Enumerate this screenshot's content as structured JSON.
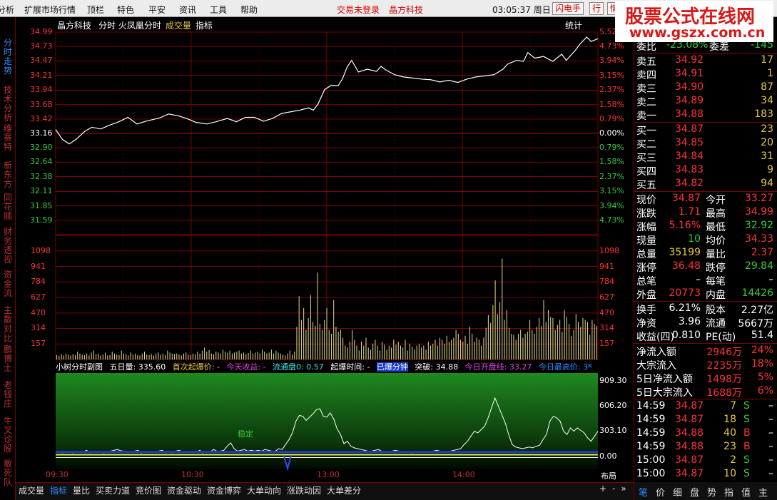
{
  "menubar": {
    "items": [
      "分析",
      "扩展市场行情",
      "顶栏",
      "特色",
      "平安",
      "资讯",
      "工具",
      "帮助"
    ],
    "status_login": "交易未登录",
    "status_stock": "晶方科技",
    "clock": "03:05:37",
    "weekday": "周日",
    "flash_button": "闪电手",
    "hang_button": "行",
    "info_button": "情"
  },
  "ad": {
    "title": "股票公式在线网",
    "url": "www.gszx.com.cn"
  },
  "left_tabs": [
    {
      "label": "分时走势",
      "active": true
    },
    {
      "label": "技术分析",
      "active": false
    },
    {
      "label": "维赛特",
      "active": false
    },
    {
      "label": "新东方",
      "active": false
    },
    {
      "label": "同花顺",
      "active": false
    },
    {
      "label": "财务透视",
      "active": false
    },
    {
      "label": "资金流",
      "active": false
    },
    {
      "label": "主散对比",
      "active": false
    },
    {
      "label": "鹏博士",
      "active": false
    },
    {
      "label": "老钱庄",
      "active": false
    },
    {
      "label": "牛叉诊股",
      "active": false
    },
    {
      "label": "敢死队",
      "active": false
    }
  ],
  "chart_header": {
    "stock_name": "晶方科技",
    "options": "分时 火凤凰分时",
    "volume": "成交量",
    "indicator": "指标",
    "stat_button": "统计"
  },
  "colors": {
    "up": "#ff3232",
    "down": "#33cc33",
    "grid": "#7a0000",
    "price_line": "#ffffff",
    "volume": "#e6dc8c",
    "equal": "#ffffff"
  },
  "chart_data": [
    {
      "type": "line",
      "name": "price",
      "ylim": [
        31.33,
        34.99
      ],
      "prev_close": 33.16,
      "left_ticks": [
        "34.99",
        "34.73",
        "34.47",
        "34.21",
        "33.94",
        "33.68",
        "33.42",
        "33.16",
        "32.90",
        "32.64",
        "32.38",
        "32.11",
        "31.85",
        "31.59"
      ],
      "right_ticks": [
        "5.52%",
        "4.73%",
        "3.94%",
        "3.15%",
        "2.37%",
        "1.58%",
        "0.79%",
        "0.00%",
        "0.79%",
        "1.58%",
        "2.37%",
        "3.15%",
        "3.94%",
        "4.73%"
      ],
      "x_ticks": [
        "09:30",
        "10:30",
        "13:00",
        "14:00"
      ],
      "x_minutes": 240,
      "points": [
        [
          0,
          33.23
        ],
        [
          3,
          33.05
        ],
        [
          6,
          32.97
        ],
        [
          9,
          33.05
        ],
        [
          13,
          33.2
        ],
        [
          16,
          33.27
        ],
        [
          20,
          33.24
        ],
        [
          24,
          33.31
        ],
        [
          28,
          33.37
        ],
        [
          32,
          33.45
        ],
        [
          36,
          33.33
        ],
        [
          40,
          33.38
        ],
        [
          46,
          33.44
        ],
        [
          50,
          33.51
        ],
        [
          54,
          33.48
        ],
        [
          58,
          33.43
        ],
        [
          62,
          33.36
        ],
        [
          67,
          33.33
        ],
        [
          71,
          33.37
        ],
        [
          76,
          33.43
        ],
        [
          80,
          33.37
        ],
        [
          84,
          33.45
        ],
        [
          88,
          33.45
        ],
        [
          92,
          33.38
        ],
        [
          96,
          33.43
        ],
        [
          100,
          33.52
        ],
        [
          104,
          33.55
        ],
        [
          108,
          33.58
        ],
        [
          112,
          33.62
        ],
        [
          114,
          33.58
        ],
        [
          116,
          33.68
        ],
        [
          119,
          33.95
        ],
        [
          122,
          34.03
        ],
        [
          125,
          34.02
        ],
        [
          127,
          34.15
        ],
        [
          129,
          34.36
        ],
        [
          131,
          34.48
        ],
        [
          134,
          34.27
        ],
        [
          138,
          34.32
        ],
        [
          142,
          34.28
        ],
        [
          144,
          34.37
        ],
        [
          146,
          34.31
        ],
        [
          150,
          34.22
        ],
        [
          154,
          34.18
        ],
        [
          158,
          34.16
        ],
        [
          162,
          34.14
        ],
        [
          166,
          34.13
        ],
        [
          170,
          34.09
        ],
        [
          174,
          34.12
        ],
        [
          178,
          34.08
        ],
        [
          182,
          34.14
        ],
        [
          186,
          34.18
        ],
        [
          190,
          34.2
        ],
        [
          194,
          34.22
        ],
        [
          198,
          34.32
        ],
        [
          200,
          34.41
        ],
        [
          204,
          34.48
        ],
        [
          207,
          34.46
        ],
        [
          209,
          34.62
        ],
        [
          212,
          34.52
        ],
        [
          216,
          34.55
        ],
        [
          220,
          34.46
        ],
        [
          224,
          34.59
        ],
        [
          226,
          34.48
        ],
        [
          230,
          34.66
        ],
        [
          232,
          34.77
        ],
        [
          235,
          34.9
        ],
        [
          237,
          34.82
        ],
        [
          240,
          34.87
        ]
      ]
    },
    {
      "type": "bar",
      "name": "volume",
      "ylim": [
        0,
        1255
      ],
      "ticks": [
        "1098",
        "941",
        "784",
        "627",
        "470",
        "314",
        "157"
      ],
      "values": [
        45,
        35,
        55,
        40,
        60,
        50,
        40,
        55,
        45,
        80,
        60,
        50,
        45,
        60,
        40,
        70,
        90,
        55,
        60,
        40,
        50,
        70,
        40,
        45,
        80,
        60,
        50,
        45,
        90,
        60,
        55,
        40,
        70,
        50,
        60,
        45,
        40,
        60,
        80,
        50,
        45,
        55,
        40,
        60,
        70,
        50,
        60,
        45,
        90,
        70,
        60,
        55,
        60,
        50,
        40,
        60,
        70,
        50,
        45,
        60,
        50,
        80,
        60,
        90,
        120,
        80,
        95,
        60,
        50,
        80,
        70,
        60,
        100,
        80,
        70,
        90,
        60,
        70,
        80,
        90,
        60,
        70,
        55,
        65,
        90,
        60,
        70,
        80,
        60,
        100,
        80,
        60,
        70,
        100,
        60,
        90,
        70,
        60,
        50,
        40,
        60,
        90,
        50,
        80,
        330,
        640,
        400,
        520,
        300,
        420,
        650,
        380,
        340,
        880,
        360,
        300,
        400,
        520,
        300,
        260,
        600,
        330,
        280,
        300,
        220,
        140,
        120,
        180,
        300,
        200,
        140,
        90,
        180,
        140,
        220,
        120,
        100,
        160,
        200,
        140,
        90,
        180,
        150,
        100,
        140,
        120,
        200,
        150,
        180,
        140,
        120,
        200,
        90,
        160,
        130,
        100,
        140,
        160,
        120,
        140,
        100,
        180,
        140,
        160,
        200,
        140,
        220,
        200,
        160,
        240,
        180,
        200,
        220,
        300,
        260,
        200,
        180,
        240,
        160,
        330,
        260,
        180,
        220,
        200,
        140,
        220,
        320,
        450,
        370,
        550,
        800,
        460,
        580,
        1020,
        400,
        500,
        320,
        260,
        250,
        200,
        260,
        300,
        220,
        260,
        280,
        400,
        300,
        260,
        330,
        420,
        340,
        600,
        380,
        500,
        430,
        420,
        300,
        350,
        400,
        280,
        500,
        430,
        360,
        240,
        300,
        460,
        380,
        330,
        420,
        400,
        380,
        250,
        400,
        360,
        340
      ]
    },
    {
      "type": "area",
      "name": "小树分时副图",
      "ylim": [
        -150,
        1000
      ],
      "ticks": [
        "909.30",
        "606.20",
        "303.10",
        "0.00"
      ],
      "annotation": "稳定",
      "values": [
        60,
        50,
        40,
        60,
        50,
        40,
        55,
        60,
        50,
        70,
        40,
        50,
        60,
        55,
        40,
        50,
        60,
        70,
        80,
        65,
        60,
        50,
        55,
        60,
        70,
        40,
        60,
        50,
        45,
        55,
        60,
        70,
        50,
        60,
        40,
        60,
        70,
        50,
        60,
        55,
        60,
        50,
        70,
        40,
        60,
        50,
        80,
        60,
        60,
        70,
        120,
        160,
        90,
        60,
        70,
        80,
        60,
        70,
        60,
        70,
        60,
        80,
        70,
        60,
        60,
        90,
        80,
        140,
        200,
        280,
        420,
        490,
        480,
        430,
        470,
        510,
        560,
        570,
        480,
        470,
        520,
        450,
        330,
        260,
        150,
        180,
        120,
        100,
        90,
        80,
        70,
        60,
        60,
        70,
        80,
        60,
        60,
        50,
        60,
        70,
        60,
        60,
        50,
        60,
        40,
        55,
        60,
        50,
        60,
        50,
        60,
        70,
        60,
        50,
        60,
        60,
        70,
        80,
        90,
        140,
        180,
        240,
        300,
        280,
        320,
        360,
        460,
        580,
        700,
        600,
        500,
        400,
        260,
        140,
        110,
        100,
        90,
        100,
        110,
        100,
        120,
        130,
        200,
        260,
        420,
        480,
        460,
        420,
        300,
        260,
        340,
        300,
        340,
        310,
        280,
        220,
        180,
        240,
        300
      ]
    }
  ],
  "indicator_header": {
    "name": "小树分时副图",
    "five_day": "五日量: 335.60",
    "first_surge": "首次起爆价: -",
    "today_gain": "今天收益: -",
    "float_cap": "流通盘0: 0.57",
    "surge_time": "起爆时间: -",
    "exploded": "已爆分钟",
    "breakthrough": "突破: 34.88",
    "today_open": "今日开盘线: 33.27",
    "today_high": "今日最高价: 3"
  },
  "bottom_tabs": [
    {
      "label": "成交量",
      "active": false
    },
    {
      "label": "指标",
      "active": true
    },
    {
      "label": "量比",
      "active": false
    },
    {
      "label": "买卖力道",
      "active": false
    },
    {
      "label": "竞价图",
      "active": false
    },
    {
      "label": "资金驱动",
      "active": false
    },
    {
      "label": "资金博弈",
      "active": false
    },
    {
      "label": "大单动向",
      "active": false
    },
    {
      "label": "涨跌动因",
      "active": false
    },
    {
      "label": "大单差分",
      "active": false
    }
  ],
  "layout_button": "布局",
  "zoom_buttons": [
    "+",
    "-",
    "»"
  ],
  "quote_panel": {
    "ratio_row": {
      "label1": "委比",
      "value1": "-23.08%",
      "label2": "委差",
      "value2": "-145"
    },
    "asks": [
      {
        "label": "卖五",
        "price": "34.92",
        "volume": "17"
      },
      {
        "label": "卖四",
        "price": "34.91",
        "volume": "1"
      },
      {
        "label": "卖三",
        "price": "34.90",
        "volume": "87"
      },
      {
        "label": "卖二",
        "price": "34.89",
        "volume": "34"
      },
      {
        "label": "卖一",
        "price": "34.88",
        "volume": "183"
      }
    ],
    "bids": [
      {
        "label": "买一",
        "price": "34.87",
        "volume": "23"
      },
      {
        "label": "买二",
        "price": "34.85",
        "volume": "20"
      },
      {
        "label": "买三",
        "price": "34.84",
        "volume": "31"
      },
      {
        "label": "买四",
        "price": "34.83",
        "volume": "9"
      },
      {
        "label": "买五",
        "price": "34.82",
        "volume": "94"
      }
    ],
    "stats": [
      {
        "l1": "现价",
        "v1": "34.87",
        "c1": "up",
        "l2": "今开",
        "v2": "33.27",
        "c2": "up"
      },
      {
        "l1": "涨跌",
        "v1": "1.71",
        "c1": "up",
        "l2": "最高",
        "v2": "34.99",
        "c2": "up"
      },
      {
        "l1": "涨幅",
        "v1": "5.16%",
        "c1": "up",
        "l2": "最低",
        "v2": "32.92",
        "c2": "down"
      },
      {
        "l1": "现量",
        "v1": "10",
        "c1": "down",
        "l2": "均价",
        "v2": "34.33",
        "c2": "up"
      },
      {
        "l1": "总量",
        "v1": "35199",
        "c1": "yellow",
        "l2": "量比",
        "v2": "2.37",
        "c2": "up"
      },
      {
        "l1": "涨停",
        "v1": "36.48",
        "c1": "up",
        "l2": "跌停",
        "v2": "29.84",
        "c2": "down"
      },
      {
        "l1": "总笔",
        "v1": "–",
        "c1": "white",
        "l2": "每笔",
        "v2": "–",
        "c2": "white"
      },
      {
        "l1": "外盘",
        "v1": "20773",
        "c1": "up",
        "l2": "内盘",
        "v2": "14426",
        "c2": "down"
      }
    ],
    "stats2": [
      {
        "l1": "换手",
        "v1": "6.21%",
        "c1": "white",
        "l2": "股本",
        "v2": "2.27亿",
        "c2": "white"
      },
      {
        "l1": "净资",
        "v1": "3.96",
        "c1": "white",
        "l2": "流通",
        "v2": "5667万",
        "c2": "white"
      },
      {
        "l1": "收益(四)",
        "v1": "0.810",
        "c1": "white",
        "l2": "PE(动)",
        "v2": "51.4",
        "c2": "white"
      }
    ],
    "flows": [
      {
        "label": "净流入额",
        "value": "2946万",
        "pct": "24%"
      },
      {
        "label": "大宗流入",
        "value": "2235万",
        "pct": "18%"
      },
      {
        "label": "5日净流入额",
        "value": "1498万",
        "pct": "5%"
      },
      {
        "label": "5日大宗流入",
        "value": "1688万",
        "pct": "6%"
      }
    ],
    "ticks": [
      {
        "time": "14:59",
        "price": "34.87",
        "vol": "7",
        "side": "S",
        "extra": "–"
      },
      {
        "time": "14:59",
        "price": "34.87",
        "vol": "18",
        "side": "S",
        "extra": "–"
      },
      {
        "time": "14:59",
        "price": "34.88",
        "vol": "40",
        "side": "B",
        "extra": "–"
      },
      {
        "time": "14:59",
        "price": "34.88",
        "vol": "23",
        "side": "B",
        "extra": "–"
      },
      {
        "time": "15:00",
        "price": "34.87",
        "vol": "2",
        "side": "S",
        "extra": "–"
      },
      {
        "time": "15:00",
        "price": "34.87",
        "vol": "10",
        "side": "S",
        "extra": "–"
      }
    ],
    "tabs": [
      "笔",
      "价",
      "细",
      "盘",
      "势",
      "指",
      "值",
      "主"
    ]
  }
}
